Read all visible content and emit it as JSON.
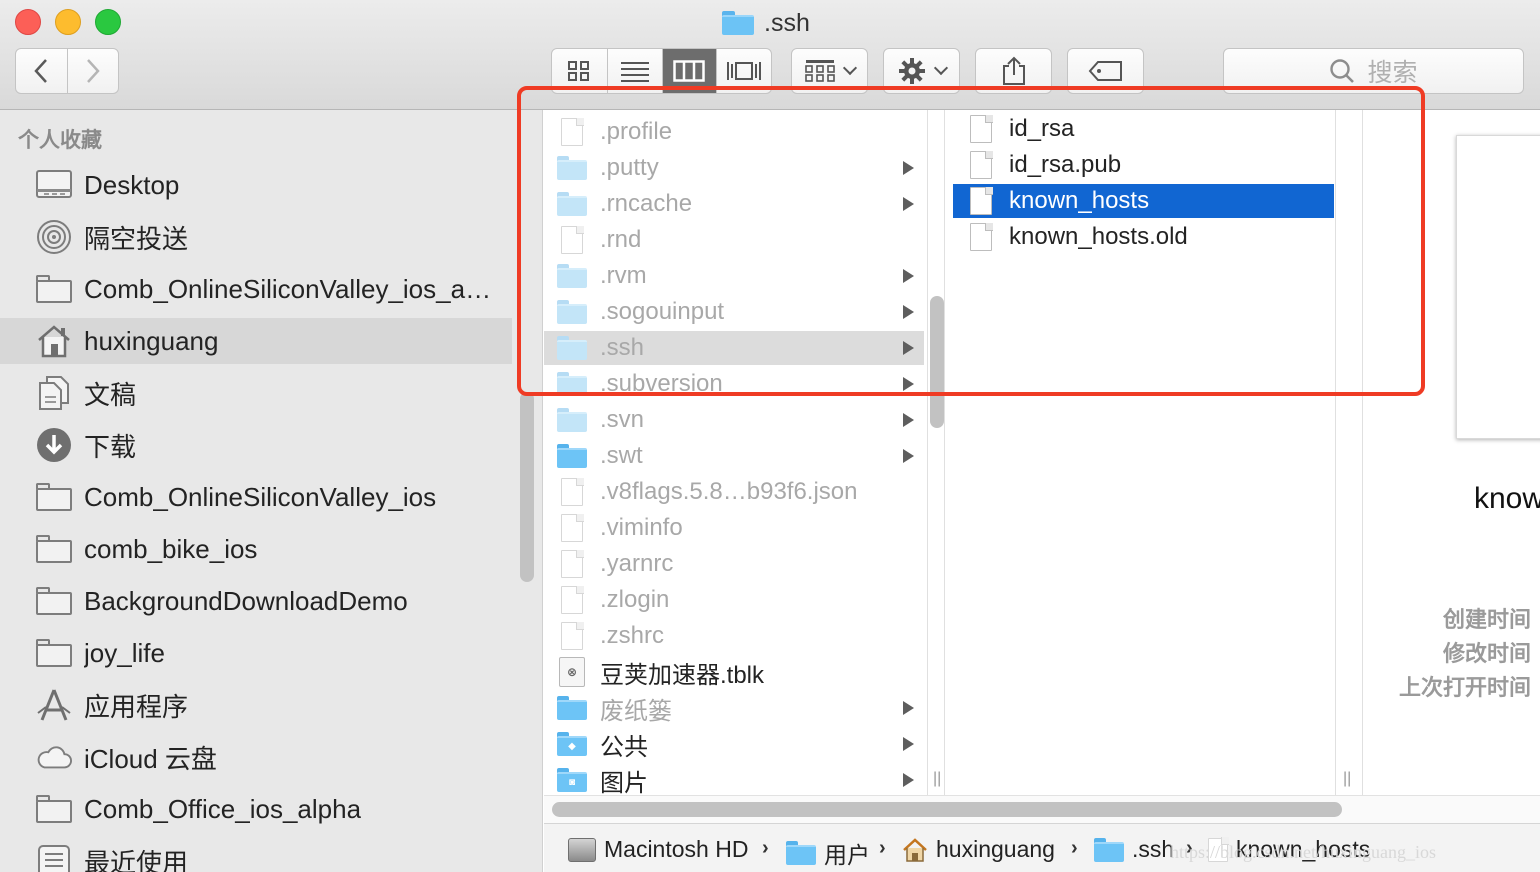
{
  "window": {
    "title": ".ssh"
  },
  "toolbar": {
    "back": "back-button",
    "forward": "forward-button",
    "search_placeholder": "搜索"
  },
  "sidebar": {
    "heading": "个人收藏",
    "items": [
      {
        "label": "Desktop",
        "icon": "desktop-icon"
      },
      {
        "label": "隔空投送",
        "icon": "airdrop-icon"
      },
      {
        "label": "Comb_OnlineSiliconValley_ios_al…",
        "icon": "folder-icon"
      },
      {
        "label": "huxinguang",
        "icon": "home-icon",
        "selected": true
      },
      {
        "label": "文稿",
        "icon": "documents-icon"
      },
      {
        "label": "下载",
        "icon": "downloads-icon"
      },
      {
        "label": "Comb_OnlineSiliconValley_ios",
        "icon": "folder-icon"
      },
      {
        "label": "comb_bike_ios",
        "icon": "folder-icon"
      },
      {
        "label": "BackgroundDownloadDemo",
        "icon": "folder-icon"
      },
      {
        "label": "joy_life",
        "icon": "folder-icon"
      },
      {
        "label": "应用程序",
        "icon": "applications-icon"
      },
      {
        "label": "iCloud 云盘",
        "icon": "icloud-icon"
      },
      {
        "label": "Comb_Office_ios_alpha",
        "icon": "folder-icon"
      },
      {
        "label": "最近使用",
        "icon": "recents-icon"
      }
    ]
  },
  "column1": {
    "items": [
      {
        "label": ".profile",
        "kind": "file",
        "dim": true
      },
      {
        "label": ".putty",
        "kind": "folder",
        "dim": true,
        "arrow": true
      },
      {
        "label": ".rncache",
        "kind": "folder",
        "dim": true,
        "arrow": true
      },
      {
        "label": ".rnd",
        "kind": "file",
        "dim": true
      },
      {
        "label": ".rvm",
        "kind": "folder",
        "dim": true,
        "arrow": true
      },
      {
        "label": ".sogouinput",
        "kind": "folder",
        "dim": true,
        "arrow": true
      },
      {
        "label": ".ssh",
        "kind": "folder",
        "dim": true,
        "arrow": true,
        "selected": true
      },
      {
        "label": ".subversion",
        "kind": "folder",
        "dim": true,
        "arrow": true
      },
      {
        "label": ".svn",
        "kind": "folder",
        "dim": true,
        "arrow": true
      },
      {
        "label": ".swt",
        "kind": "folder",
        "dim": true,
        "arrow": true
      },
      {
        "label": ".v8flags.5.8…b93f6.json",
        "kind": "file",
        "dim": true
      },
      {
        "label": ".viminfo",
        "kind": "file",
        "dim": true
      },
      {
        "label": ".yarnrc",
        "kind": "file",
        "dim": true
      },
      {
        "label": ".zlogin",
        "kind": "file",
        "dim": true
      },
      {
        "label": ".zshrc",
        "kind": "file",
        "dim": true
      },
      {
        "label": "豆荚加速器.tblk",
        "kind": "tblk",
        "dim": false
      },
      {
        "label": "废纸篓",
        "kind": "folder",
        "dim": true,
        "arrow": true
      },
      {
        "label": "公共",
        "kind": "folder-public",
        "dim": false,
        "arrow": true
      },
      {
        "label": "图片",
        "kind": "folder-pictures",
        "dim": false,
        "arrow": true
      }
    ]
  },
  "column2": {
    "items": [
      {
        "label": "id_rsa"
      },
      {
        "label": "id_rsa.pub"
      },
      {
        "label": "known_hosts",
        "selected": true
      },
      {
        "label": "known_hosts.old"
      }
    ]
  },
  "preview": {
    "name": "known_hosts",
    "meta": [
      "创建时间",
      "修改时间",
      "上次打开时间"
    ]
  },
  "pathbar": {
    "segments": [
      "Macintosh HD",
      "用户",
      "huxinguang",
      ".ssh",
      "known_hosts"
    ]
  },
  "watermark": "https://blog.csdn.net/huxinguang_ios",
  "colors": {
    "selection": "#1166d2",
    "annotation": "#ef3b24"
  }
}
